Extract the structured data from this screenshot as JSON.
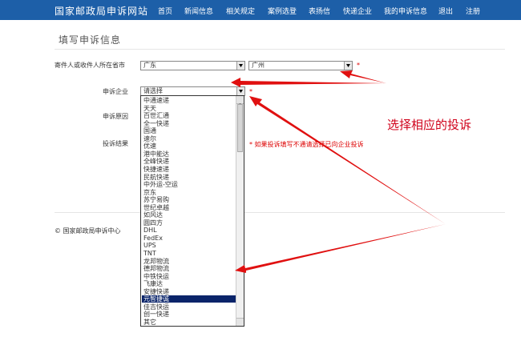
{
  "header": {
    "site_title": "国家邮政局申诉网站",
    "nav": [
      {
        "label": "首页"
      },
      {
        "label": "新闻信息"
      },
      {
        "label": "相关规定"
      },
      {
        "label": "案例选登"
      },
      {
        "label": "表扬信"
      },
      {
        "label": "快递企业"
      },
      {
        "label": "我的申诉信息"
      },
      {
        "label": "退出"
      },
      {
        "label": "注册"
      }
    ]
  },
  "form": {
    "section_title": "填写申诉信息",
    "province_label": "寄件人或收件人所在省市",
    "province_value": "广东",
    "city_value": "广州",
    "required_mark": "*",
    "company_label": "申诉企业",
    "company_value": "请选择",
    "reason_label": "申诉原因",
    "result_label": "投诉结果",
    "hint": "* 如果投诉填写不通请选择已向企业投诉"
  },
  "dropdown": {
    "selected_index": 26,
    "options": [
      "中通速递",
      "天天",
      "百世汇通",
      "全一快递",
      "国通",
      "速尔",
      "优速",
      "港中能达",
      "全峰快递",
      "快捷速递",
      "民航快递",
      "中外运-空运",
      "京东",
      "苏宁易购",
      "世纪卓越",
      "如风达",
      "圆四方",
      "DHL",
      "FedEx",
      "UPS",
      "TNT",
      "龙邦物流",
      "德邦物流",
      "中铁快运",
      "飞康达",
      "安捷快递",
      "元智捷诚",
      "佳吉快运",
      "创一快递",
      "其它"
    ]
  },
  "footer": {
    "text": "© 国家邮政局申诉中心"
  },
  "annotation": {
    "text": "选择相应的投诉",
    "color": "#d0021b"
  }
}
